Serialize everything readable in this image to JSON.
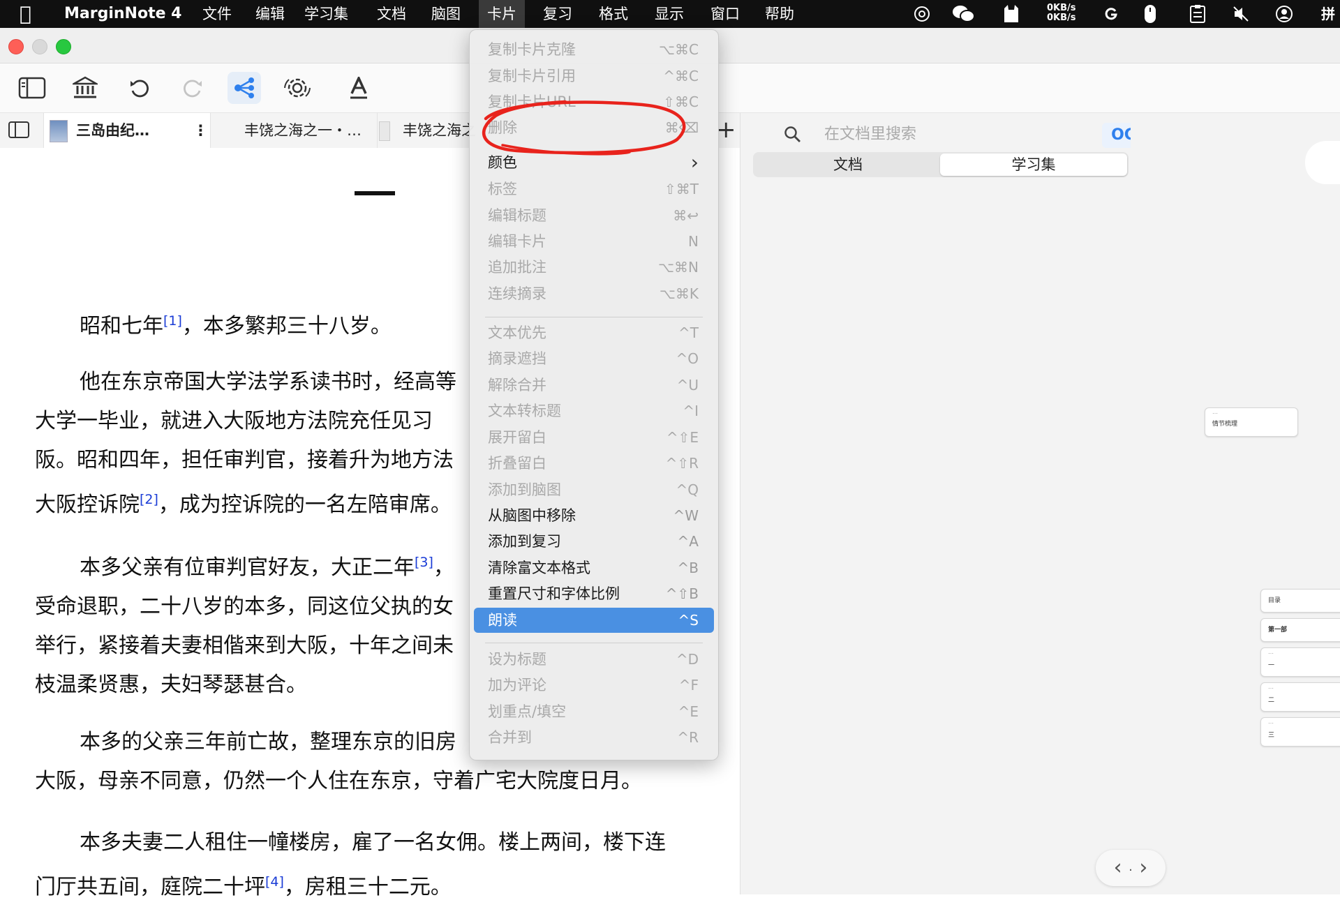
{
  "menubar": {
    "app_name": "MarginNote 4",
    "items": [
      "文件",
      "编辑",
      "学习集",
      "文档",
      "脑图",
      "卡片",
      "复习",
      "格式",
      "显示",
      "窗口",
      "帮助"
    ],
    "active_item": "卡片",
    "net_up": "0KB/s",
    "net_down": "0KB/s",
    "input_method": "拼"
  },
  "tabs": [
    {
      "label": "三岛由纪…",
      "active": true
    },
    {
      "label": "丰饶之海之一・…",
      "active": false
    },
    {
      "label": "丰饶之海之",
      "active": false
    }
  ],
  "search": {
    "placeholder": "在文档里搜索",
    "ocr_label": "OCR"
  },
  "segments": [
    "文档",
    "学习集"
  ],
  "selected_segment": "学习集",
  "mindmap": {
    "nodes": [
      "情节梳理",
      "目录",
      "第一部",
      "一",
      "二",
      "三"
    ]
  },
  "document": {
    "chapter_mark": "一",
    "paragraphs": [
      {
        "lines": [
          {
            "pre": "昭和七年",
            "sup": "[1]",
            "post": "，本多繁邦三十八岁。"
          }
        ]
      },
      {
        "lines": [
          {
            "pre": "他在东京帝国大学法学系读书时，经高等"
          },
          {
            "pre": "大学一毕业，就进入大阪地方法院充任见习"
          },
          {
            "pre": "阪。昭和四年，担任审判官，接着升为地方法"
          },
          {
            "pre": "大阪控诉院",
            "sup": "[2]",
            "post": "，成为控诉院的一名左陪审席。"
          }
        ]
      },
      {
        "lines": [
          {
            "pre": "本多父亲有位审判官好友，大正二年",
            "sup": "[3]",
            "post": "，"
          },
          {
            "pre": "受命退职，二十八岁的本多，同这位父执的女"
          },
          {
            "pre": "举行，紧接着夫妻相偕来到大阪，十年之间未"
          },
          {
            "pre": "枝温柔贤惠，夫妇琴瑟甚合。"
          }
        ]
      },
      {
        "lines": [
          {
            "pre": "本多的父亲三年前亡故，整理东京的旧房"
          },
          {
            "pre": "大阪，母亲不同意，仍然一个人住在东京，守着广宅大院度日月。"
          }
        ]
      },
      {
        "lines": [
          {
            "pre": "本多夫妻二人租住一幢楼房，雇了一名女佣。楼上两间，楼下连"
          },
          {
            "pre": "门厅共五间，庭院二十坪",
            "sup": "[4]",
            "post": "，房租三十二元。"
          }
        ]
      }
    ]
  },
  "context_menu": {
    "items": [
      {
        "label": "复制卡片克隆",
        "shortcut": "⌥⌘C",
        "enabled": false
      },
      {
        "label": "复制卡片引用",
        "shortcut": "^⌘C",
        "enabled": false
      },
      {
        "label": "复制卡片URL",
        "shortcut": "⇧⌘C",
        "enabled": false
      },
      {
        "label": "删除",
        "shortcut": "⌘⌫",
        "enabled": false,
        "circled": true
      },
      {
        "label": "颜色",
        "shortcut": "›",
        "enabled": true
      },
      {
        "label": "标签",
        "shortcut": "⇧⌘T",
        "enabled": false
      },
      {
        "label": "编辑标题",
        "shortcut": "⌘↩",
        "enabled": false
      },
      {
        "label": "编辑卡片",
        "shortcut": "N",
        "enabled": false
      },
      {
        "label": "追加批注",
        "shortcut": "⌥⌘N",
        "enabled": false
      },
      {
        "label": "连续摘录",
        "shortcut": "⌥⌘K",
        "enabled": false
      },
      {
        "label": "文本优先",
        "shortcut": "^T",
        "enabled": false
      },
      {
        "label": "摘录遮挡",
        "shortcut": "^O",
        "enabled": false
      },
      {
        "label": "解除合并",
        "shortcut": "^U",
        "enabled": false
      },
      {
        "label": "文本转标题",
        "shortcut": "^I",
        "enabled": false
      },
      {
        "label": "展开留白",
        "shortcut": "^⇧E",
        "enabled": false
      },
      {
        "label": "折叠留白",
        "shortcut": "^⇧R",
        "enabled": false
      },
      {
        "label": "添加到脑图",
        "shortcut": "^Q",
        "enabled": false
      },
      {
        "label": "从脑图中移除",
        "shortcut": "^W",
        "enabled": true
      },
      {
        "label": "添加到复习",
        "shortcut": "^A",
        "enabled": true
      },
      {
        "label": "清除富文本格式",
        "shortcut": "^B",
        "enabled": true
      },
      {
        "label": "重置尺寸和字体比例",
        "shortcut": "^⇧B",
        "enabled": true
      },
      {
        "label": "朗读",
        "shortcut": "^S",
        "enabled": true,
        "highlighted": true
      },
      {
        "label": "设为标题",
        "shortcut": "^D",
        "enabled": false
      },
      {
        "label": "加为评论",
        "shortcut": "^F",
        "enabled": false
      },
      {
        "label": "划重点/填空",
        "shortcut": "^E",
        "enabled": false
      },
      {
        "label": "合并到",
        "shortcut": "^R",
        "enabled": false
      }
    ]
  },
  "colors": {
    "menu_highlight": "#4a90e2",
    "annotation_circle": "#e8231c",
    "ocr": "#2f80ed",
    "footnote_link": "#1a3cd6"
  }
}
